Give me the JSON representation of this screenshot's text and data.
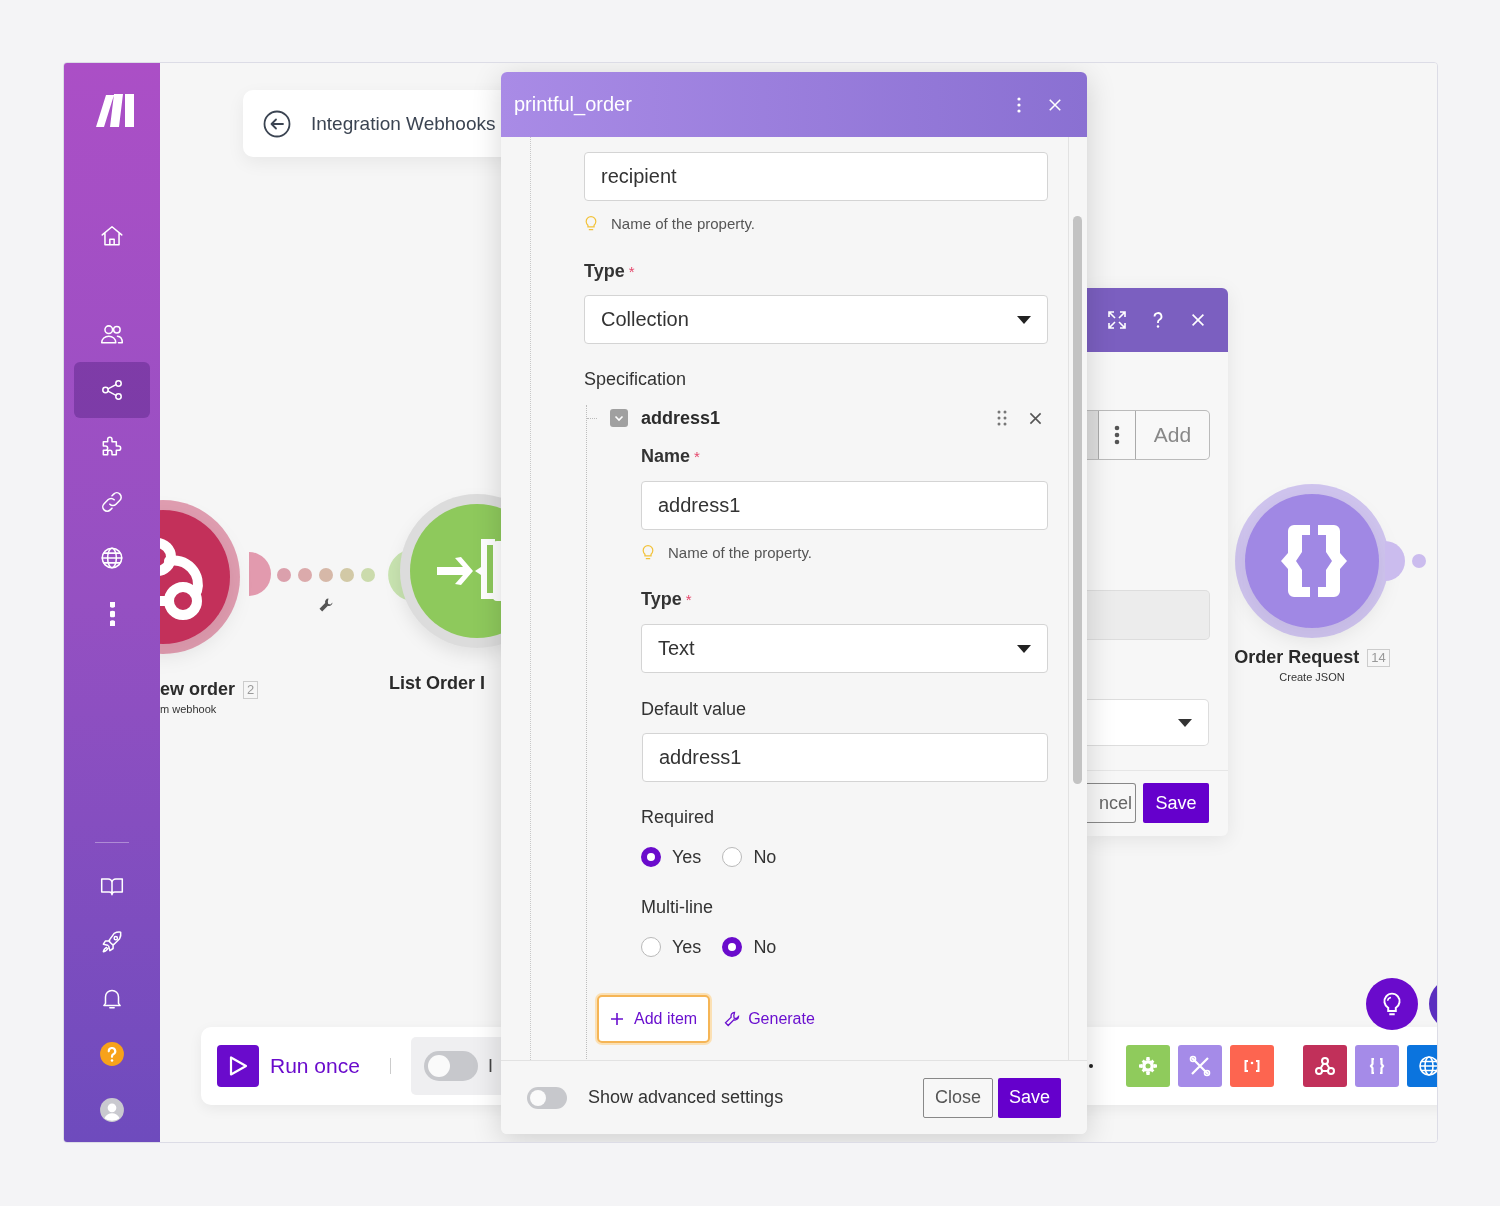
{
  "sidebar": {
    "items": [
      {
        "kind": "home",
        "selected": false
      },
      {
        "kind": "team",
        "selected": false
      },
      {
        "kind": "share",
        "selected": true
      },
      {
        "kind": "puzzle",
        "selected": false
      },
      {
        "kind": "link",
        "selected": false
      },
      {
        "kind": "globe",
        "selected": false
      },
      {
        "kind": "more",
        "selected": false
      }
    ],
    "bottom_items": [
      {
        "kind": "book",
        "selected": false
      },
      {
        "kind": "rocket",
        "selected": false
      },
      {
        "kind": "bell",
        "selected": false
      },
      {
        "kind": "help",
        "selected": false
      },
      {
        "kind": "avatar",
        "selected": false
      }
    ]
  },
  "canvas": {
    "header": {
      "title": "Integration Webhooks"
    },
    "nodes": [
      {
        "kind": "webhook",
        "title": "ew order",
        "count": "2",
        "subtitle": "m webhook",
        "color": "#c3305a"
      },
      {
        "kind": "iterator",
        "title": "List Order I",
        "color": "#8ec95c"
      },
      {
        "kind": "json",
        "title": "Order Request",
        "count": "14",
        "subtitle": "Create JSON",
        "color": "#a088e4"
      }
    ]
  },
  "toolbar": {
    "run_label": "Run once",
    "scheduling": {
      "on": false,
      "label": "I"
    },
    "tools": [
      {
        "kind": "gear",
        "color": "#8fcb5c"
      },
      {
        "kind": "tools",
        "color": "#a58be8"
      },
      {
        "kind": "brackets",
        "color": "#fd6550"
      },
      {
        "kind": "webhook",
        "color": "#c1305a"
      },
      {
        "kind": "braces",
        "color": "#a58be8"
      },
      {
        "kind": "globe",
        "color": "#0b74de"
      }
    ]
  },
  "back_dialog": {
    "add_label": "Add",
    "cancel_label": "ncel",
    "save_label": "Save"
  },
  "dialog": {
    "title": "printful_order",
    "name_field": {
      "value": "recipient",
      "hint": "Name of the property."
    },
    "type": {
      "label": "Type",
      "required_mark": "*",
      "value": "Collection"
    },
    "specification": {
      "label": "Specification",
      "items": [
        {
          "title": "address1",
          "expanded": true,
          "name": {
            "label": "Name",
            "required_mark": "*",
            "value": "address1",
            "hint": "Name of the property."
          },
          "type": {
            "label": "Type",
            "required_mark": "*",
            "value": "Text"
          },
          "default_value": {
            "label": "Default value",
            "value": "address1"
          },
          "options": [
            {
              "label": "Required",
              "choices": [
                {
                  "label": "Yes",
                  "selected": true
                },
                {
                  "label": "No",
                  "selected": false
                }
              ]
            },
            {
              "label": "Multi-line",
              "choices": [
                {
                  "label": "Yes",
                  "selected": false
                },
                {
                  "label": "No",
                  "selected": true
                }
              ]
            }
          ]
        }
      ],
      "add_button": {
        "label": "Add item",
        "focused": true
      },
      "generate_label": "Generate"
    },
    "advanced": {
      "label": "Show advanced settings",
      "on": false
    },
    "buttons": [
      {
        "label": "Close",
        "kind": "secondary"
      },
      {
        "label": "Save",
        "kind": "primary"
      }
    ]
  }
}
